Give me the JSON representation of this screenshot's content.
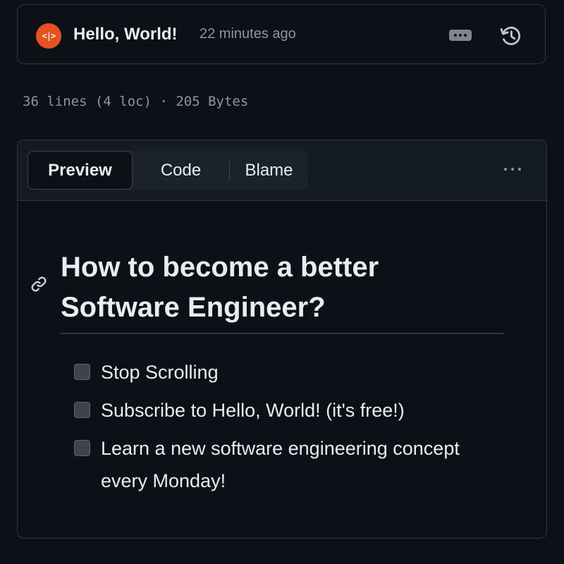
{
  "commit": {
    "author": "Hello, World!",
    "avatar_text": "<|>",
    "time_ago": "22 minutes ago",
    "icons": [
      "ellipsis-icon",
      "history-icon"
    ]
  },
  "file_meta": "36 lines (4 loc) · 205 Bytes",
  "tabs": [
    {
      "label": "Preview",
      "active": true
    },
    {
      "label": "Code",
      "active": false
    },
    {
      "label": "Blame",
      "active": false
    }
  ],
  "heading": "How to become a better Software Engineer?",
  "tasks": [
    {
      "label": "Stop Scrolling",
      "checked": false
    },
    {
      "label": "Subscribe to Hello, World! (it's free!)",
      "checked": false
    },
    {
      "label": "Learn a new software engineering concept every Monday!",
      "checked": false
    }
  ],
  "colors": {
    "background": "#0d1117",
    "border": "#30363d",
    "text": "#e6edf3",
    "muted": "#8d96a0",
    "avatar": "#e8501f"
  }
}
